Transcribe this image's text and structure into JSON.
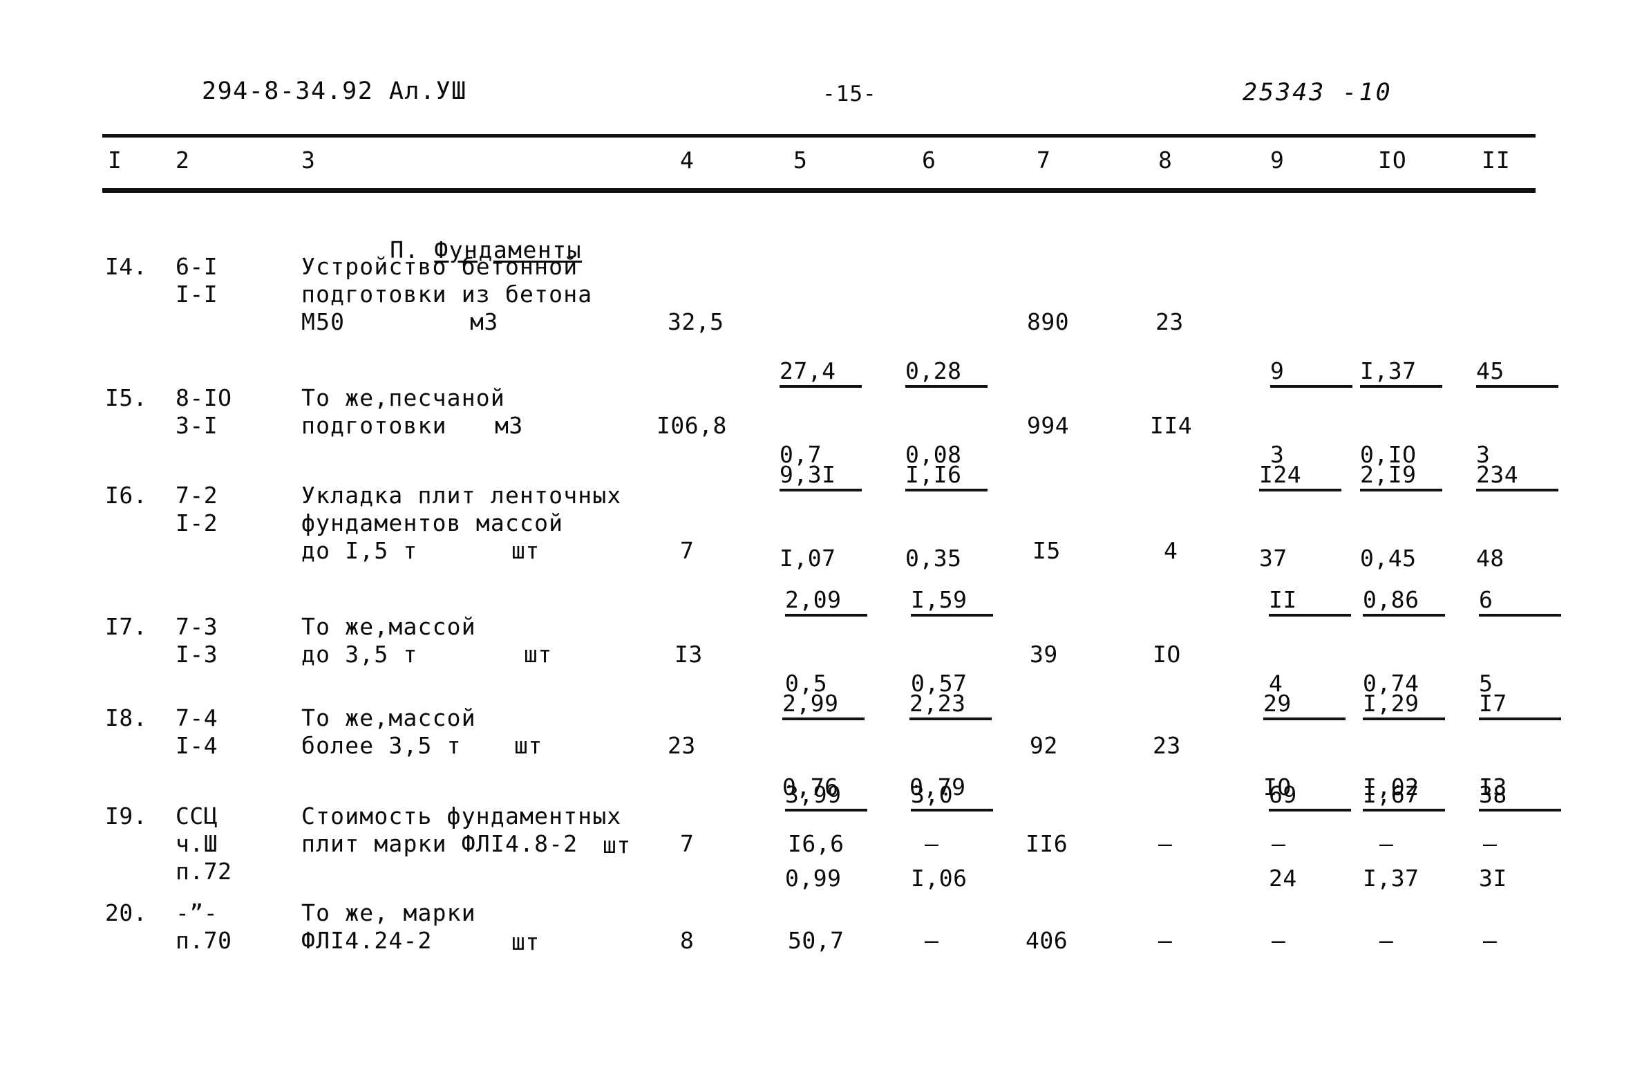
{
  "header": {
    "left": "294-8-34.92  Ал.УШ",
    "page_number": "-15-",
    "doc_code": "25343 -10"
  },
  "column_headers": [
    "I",
    "2",
    "3",
    "4",
    "5",
    "6",
    "7",
    "8",
    "9",
    "IO",
    "II"
  ],
  "section": {
    "number": "П.",
    "title": "Фундаменты"
  },
  "rows": [
    {
      "no": "I4.",
      "code_line1": "6-I",
      "code_line2": "I-I",
      "desc_line1": "Устройство бетонной",
      "desc_line2": "подготовки из бетона",
      "desc_line3": "М50",
      "unit": "м3",
      "c4": "32,5",
      "c5_num": "27,4",
      "c5_den": "0,7",
      "c6_num": "0,28",
      "c6_den": "0,08",
      "c7": "890",
      "c8": "23",
      "c9_num": "9",
      "c9_den": "3",
      "c10_num": "I,37",
      "c10_den": "0,IO",
      "c11_num": "45",
      "c11_den": "3"
    },
    {
      "no": "I5.",
      "code_line1": "8-IO",
      "code_line2": "3-I",
      "desc_line1": "То же,песчаной",
      "desc_line2": "подготовки",
      "desc_line3": "",
      "unit": "м3",
      "c4": "I06,8",
      "c5_num": "9,3I",
      "c5_den": "I,07",
      "c6_num": "I,I6",
      "c6_den": "0,35",
      "c7": "994",
      "c8": "II4",
      "c9_num": "I24",
      "c9_den": "37",
      "c10_num": "2,I9",
      "c10_den": "0,45",
      "c11_num": "234",
      "c11_den": "48"
    },
    {
      "no": "I6.",
      "code_line1": "7-2",
      "code_line2": "I-2",
      "desc_line1": "Укладка плит ленточных",
      "desc_line2": "фундаментов массой",
      "desc_line3": "до I,5 т",
      "unit": "шт",
      "c4": "7",
      "c5_num": "2,09",
      "c5_den": "0,5",
      "c6_num": "I,59",
      "c6_den": "0,57",
      "c7": "I5",
      "c8": "4",
      "c9_num": "II",
      "c9_den": "4",
      "c10_num": "0,86",
      "c10_den": "0,74",
      "c11_num": "6",
      "c11_den": "5"
    },
    {
      "no": "I7.",
      "code_line1": "7-3",
      "code_line2": "I-3",
      "desc_line1": "То же,массой",
      "desc_line2": "до 3,5 т",
      "desc_line3": "",
      "unit": "шт",
      "c4": "I3",
      "c5_num": "2,99",
      "c5_den": "0,76",
      "c6_num": "2,23",
      "c6_den": "0,79",
      "c7": "39",
      "c8": "IO",
      "c9_num": "29",
      "c9_den": "IO",
      "c10_num": "I,29",
      "c10_den": "I,02",
      "c11_num": "I7",
      "c11_den": "I3"
    },
    {
      "no": "I8.",
      "code_line1": "7-4",
      "code_line2": "I-4",
      "desc_line1": "То же,массой",
      "desc_line2": "более 3,5 т",
      "desc_line3": "",
      "unit": "шт",
      "c4": "23",
      "c5_num": "3,99",
      "c5_den": "0,99",
      "c6_num": "3,0",
      "c6_den": "I,06",
      "c7": "92",
      "c8": "23",
      "c9_num": "69",
      "c9_den": "24",
      "c10_num": "I,67",
      "c10_den": "I,37",
      "c11_num": "38",
      "c11_den": "3I"
    },
    {
      "no": "I9.",
      "code_line1": "ССЦ",
      "code_line2": "ч.Ш",
      "code_line3": "п.72",
      "desc_line1": "Стоимость фундаментных",
      "desc_line2": "плит марки ФЛI4.8-2",
      "desc_line3": "",
      "unit": "шт",
      "c4": "7",
      "c5": "I6,6",
      "c6": "–",
      "c7": "II6",
      "c8": "–",
      "c9": "–",
      "c10": "–",
      "c11": "–"
    },
    {
      "no": "20.",
      "code_line1": "-”-",
      "code_line2": "п.70",
      "desc_line1": "То же, марки",
      "desc_line2": "ФЛI4.24-2",
      "desc_line3": "",
      "unit": "шт",
      "c4": "8",
      "c5": "50,7",
      "c6": "–",
      "c7": "406",
      "c8": "–",
      "c9": "–",
      "c10": "–",
      "c11": "–"
    }
  ]
}
